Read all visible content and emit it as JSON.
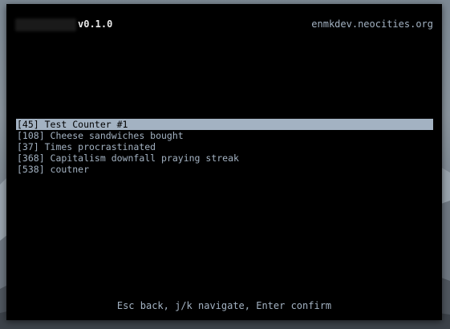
{
  "app": {
    "version": "v0.1.0",
    "site": "enmkdev.neocities.org"
  },
  "counters": [
    {
      "label": "[45] Test Counter #1",
      "selected": true
    },
    {
      "label": "[108] Cheese sandwiches bought",
      "selected": false
    },
    {
      "label": "[37] Times procrastinated",
      "selected": false
    },
    {
      "label": "[368] Capitalism downfall praying streak",
      "selected": false
    },
    {
      "label": "[538] coutner",
      "selected": false
    }
  ],
  "help": "Esc back, j/k navigate, Enter confirm",
  "colors": {
    "terminal_bg": "#000000",
    "text": "#a3b2c2",
    "highlight_bg": "#a3b2c2",
    "version_text": "#e8e8e8"
  }
}
